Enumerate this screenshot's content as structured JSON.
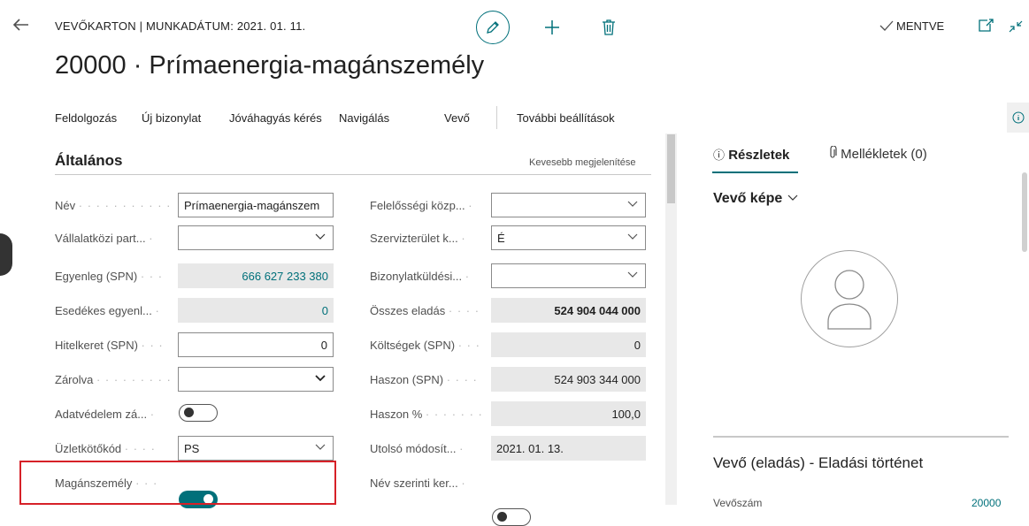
{
  "header": {
    "caption": "VEVŐKARTON | MUNKADÁTUM: 2021. 01. 11.",
    "saved": "MENTVE",
    "title": "20000 · Prímaenergia-magánszemély",
    "icons": [
      "back-arrow-icon",
      "pencil-icon",
      "plus-icon",
      "trash-icon",
      "checkmark-icon",
      "open-new-window-icon",
      "collapse-icon"
    ]
  },
  "actions": [
    "Feldolgozás",
    "Új bizonylat",
    "Jóváhagyás kérés",
    "Navigálás",
    "Vevő",
    "További beállítások"
  ],
  "section": {
    "title": "Általános",
    "link": "Kevesebb megjelenítése"
  },
  "left_fields": [
    {
      "label": "Név",
      "value": "Prímaenergia-magánszem",
      "type": "input"
    },
    {
      "label": "Vállalatközi part...",
      "value": "",
      "type": "select"
    },
    {
      "label": "Egyenleg (SPN)",
      "value": "666 627 233 380",
      "type": "readonly-link"
    },
    {
      "label": "Esedékes egyenl...",
      "value": "0",
      "type": "readonly-link"
    },
    {
      "label": "Hitelkeret (SPN)",
      "value": "0",
      "type": "input-number"
    },
    {
      "label": "Zárolva",
      "value": "",
      "type": "select"
    },
    {
      "label": "Adatvédelem zá...",
      "value": "off",
      "type": "toggle"
    },
    {
      "label": "Üzletkötőkód",
      "value": "PS",
      "type": "select"
    },
    {
      "label": "Magánszemély",
      "value": "on",
      "type": "toggle"
    }
  ],
  "right_fields": [
    {
      "label": "Felelősségi közp...",
      "value": "",
      "type": "select"
    },
    {
      "label": "Szervizterület k...",
      "value": "É",
      "type": "select"
    },
    {
      "label": "Bizonylatküldési...",
      "value": "",
      "type": "select"
    },
    {
      "label": "Összes eladás",
      "value": "524 904 044 000",
      "type": "readonly-bold"
    },
    {
      "label": "Költségek (SPN)",
      "value": "0",
      "type": "readonly"
    },
    {
      "label": "Haszon (SPN)",
      "value": "524 903 344 000",
      "type": "readonly"
    },
    {
      "label": "Haszon %",
      "value": "100,0",
      "type": "readonly"
    },
    {
      "label": "Utolsó módosít...",
      "value": "2021. 01. 13.",
      "type": "readonly-left"
    },
    {
      "label": "Név szerinti ker...",
      "value": "off",
      "type": "toggle"
    }
  ],
  "factbox": {
    "tabs": [
      "Részletek",
      "Mellékletek (0)"
    ],
    "picture_title": "Vevő képe",
    "history_title": "Vevő (eladás) - Eladási történet",
    "cut_row_label": "Vevőszám",
    "cut_row_value": "20000"
  },
  "colors": {
    "accent": "#00707a",
    "highlight": "#d62128",
    "readonly": "#e8e8e8"
  }
}
